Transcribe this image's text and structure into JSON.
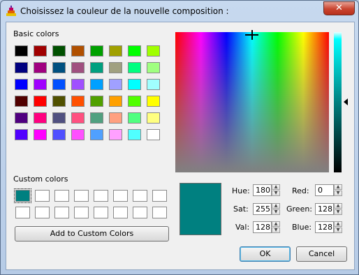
{
  "window": {
    "title": "Choisissez la couleur de la nouvelle composition :",
    "close_label": "✕"
  },
  "basic_colors": {
    "label": "Basic colors",
    "rows": [
      [
        "#000000",
        "#a00000",
        "#005000",
        "#b05000",
        "#00a000",
        "#a0a000",
        "#00ff00",
        "#a0ff00"
      ],
      [
        "#000080",
        "#a00080",
        "#005080",
        "#a05080",
        "#00a080",
        "#a0a080",
        "#00ff80",
        "#a0ff80"
      ],
      [
        "#0000ff",
        "#a000ff",
        "#0050ff",
        "#a050ff",
        "#00a0ff",
        "#a0a0ff",
        "#00ffff",
        "#a0ffff"
      ],
      [
        "#500000",
        "#ff0000",
        "#505000",
        "#ff5000",
        "#50a000",
        "#ffa000",
        "#50ff00",
        "#ffff00"
      ],
      [
        "#500080",
        "#ff0080",
        "#505080",
        "#ff5080",
        "#50a080",
        "#ffa080",
        "#50ff80",
        "#ffff80"
      ],
      [
        "#5000ff",
        "#ff00ff",
        "#5050ff",
        "#ff50ff",
        "#50a0ff",
        "#ffa0ff",
        "#50ffff",
        "#ffffff"
      ]
    ]
  },
  "custom_colors": {
    "label": "Custom colors",
    "slots": [
      "#008080",
      "#ffffff",
      "#ffffff",
      "#ffffff",
      "#ffffff",
      "#ffffff",
      "#ffffff",
      "#ffffff",
      "#ffffff",
      "#ffffff",
      "#ffffff",
      "#ffffff",
      "#ffffff",
      "#ffffff",
      "#ffffff",
      "#ffffff"
    ],
    "add_button": "Add to Custom Colors"
  },
  "current_color": "#008080",
  "fields": {
    "hue": {
      "label": "Hue:",
      "value": "180"
    },
    "sat": {
      "label": "Sat:",
      "value": "255"
    },
    "val": {
      "label": "Val:",
      "value": "128"
    },
    "red": {
      "label": "Red:",
      "value": "0"
    },
    "green": {
      "label": "Green:",
      "value": "128"
    },
    "blue": {
      "label": "Blue:",
      "value": "128"
    }
  },
  "buttons": {
    "ok": "OK",
    "cancel": "Cancel"
  }
}
